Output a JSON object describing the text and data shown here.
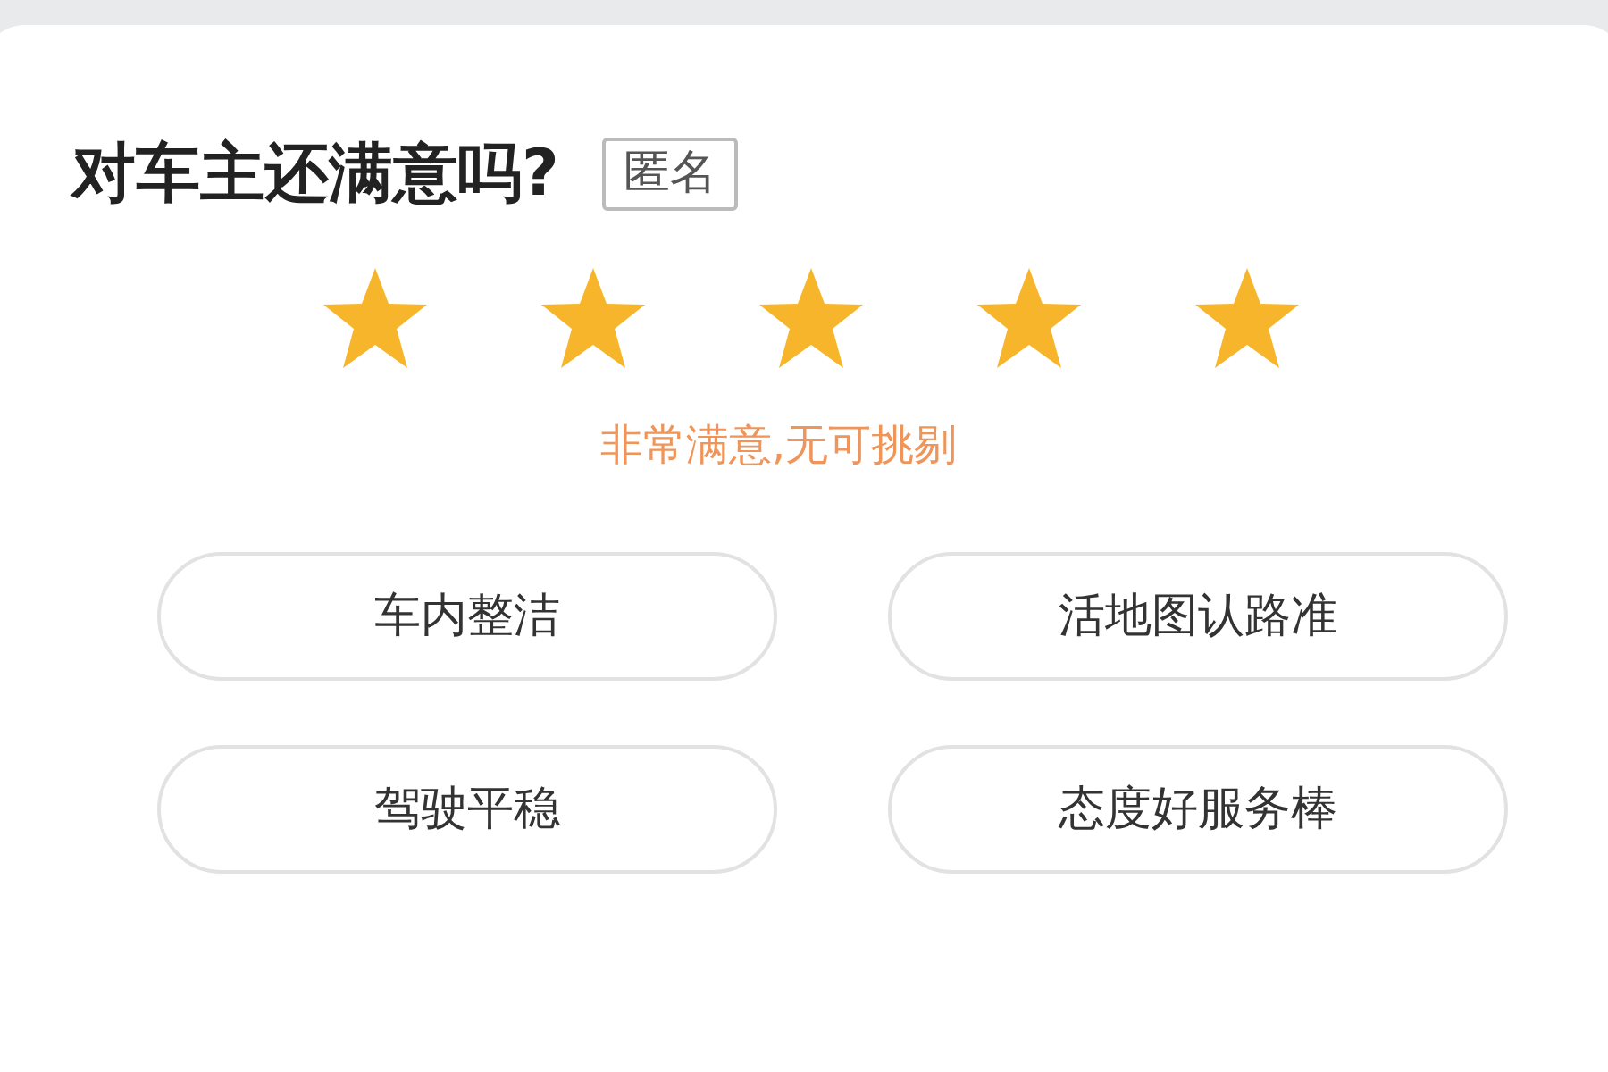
{
  "title": "对车主还满意吗?",
  "anonymous_button": {
    "label": "匿名",
    "selected": false
  },
  "rating": {
    "stars": 5,
    "caption": "非常满意,无可挑剔"
  },
  "tags": [
    {
      "label": "车内整洁",
      "selected": false
    },
    {
      "label": "活地图认路准",
      "selected": false
    },
    {
      "label": "驾驶平稳",
      "selected": false
    },
    {
      "label": "态度好服务棒",
      "selected": false
    }
  ]
}
